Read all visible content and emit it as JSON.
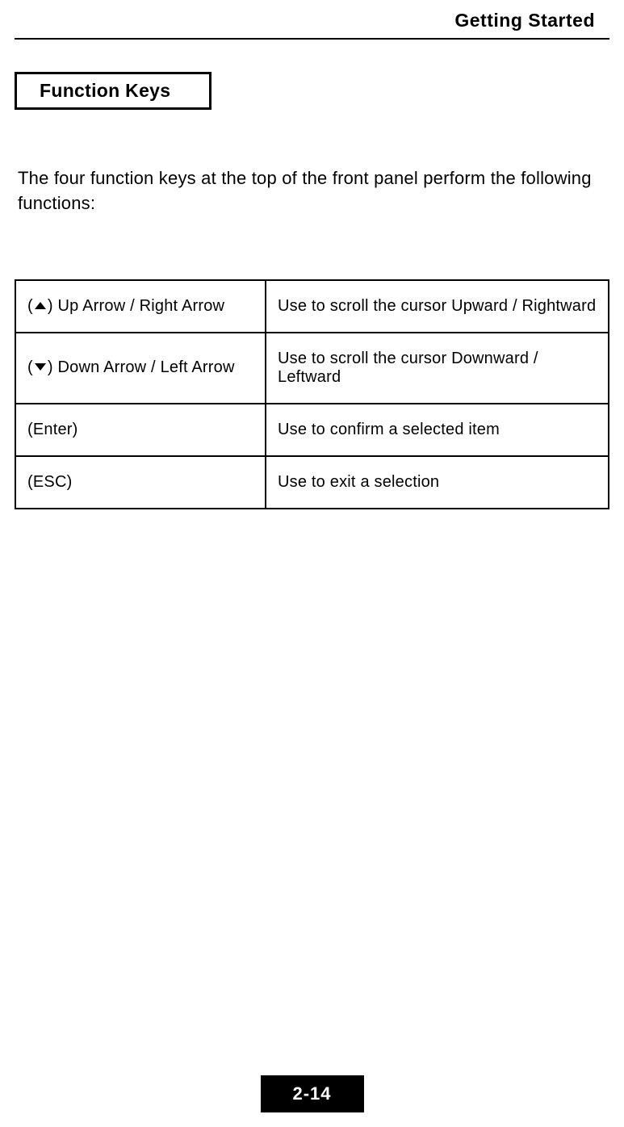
{
  "header": {
    "title": "Getting Started"
  },
  "section": {
    "title": "Function Keys",
    "intro": "The four function keys at the top of the front panel perform the following functions:"
  },
  "table": {
    "rows": [
      {
        "key_prefix": "(",
        "key_icon": "up",
        "key_suffix": ") Up Arrow / Right Arrow",
        "desc": "Use to scroll the cursor Upward / Rightward"
      },
      {
        "key_prefix": "(",
        "key_icon": "down",
        "key_suffix": ") Down Arrow / Left Arrow",
        "desc": "Use to scroll the cursor Downward / Leftward"
      },
      {
        "key_prefix": "",
        "key_icon": "",
        "key_suffix": "(Enter)",
        "desc": "Use to confirm a selected item"
      },
      {
        "key_prefix": "",
        "key_icon": "",
        "key_suffix": "(ESC)",
        "desc": "Use to exit a selection"
      }
    ]
  },
  "footer": {
    "page_number": "2-14"
  }
}
